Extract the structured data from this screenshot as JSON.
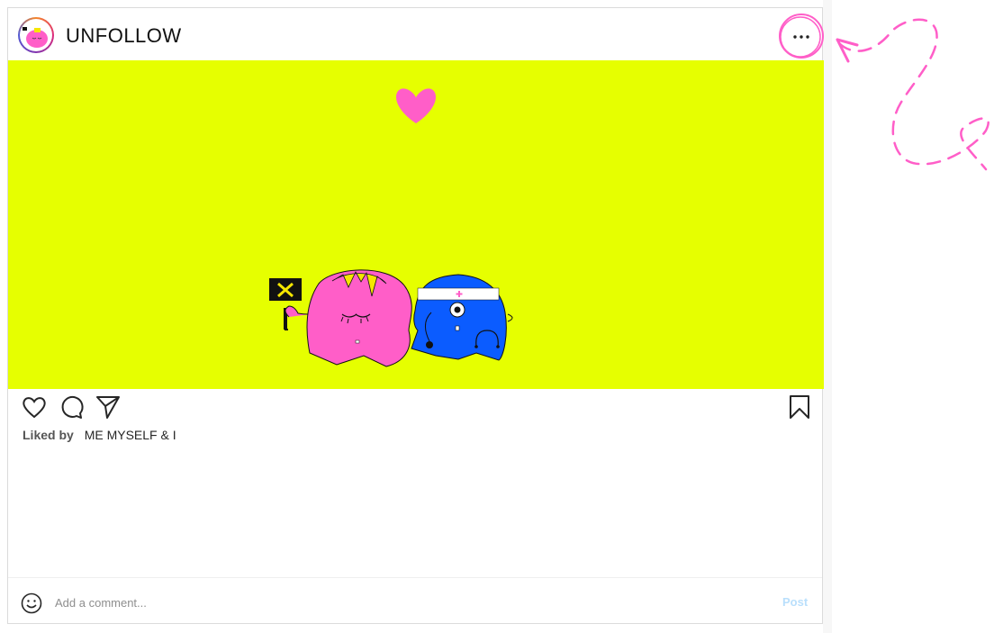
{
  "header": {
    "username": "UNFOLLOW",
    "avatar_icon": "pink-blob-avatar-icon",
    "more_icon": "more-dots-icon"
  },
  "post": {
    "background_color": "#e6ff00",
    "heart_color": "#ff5ec8",
    "pink_character_color": "#ff5ec8",
    "blue_character_color": "#0b5cff",
    "sign_text": "✕"
  },
  "actions": {
    "like_icon": "heart-outline-icon",
    "comment_icon": "comment-bubble-icon",
    "share_icon": "paper-plane-icon",
    "save_icon": "bookmark-icon"
  },
  "likes": {
    "label": "Liked by",
    "name": "ME MYSELF & I"
  },
  "comment": {
    "placeholder": "Add a comment...",
    "post_label": "Post",
    "emoji_icon": "smiley-icon"
  },
  "annotation": {
    "color": "#ff5ec8"
  }
}
